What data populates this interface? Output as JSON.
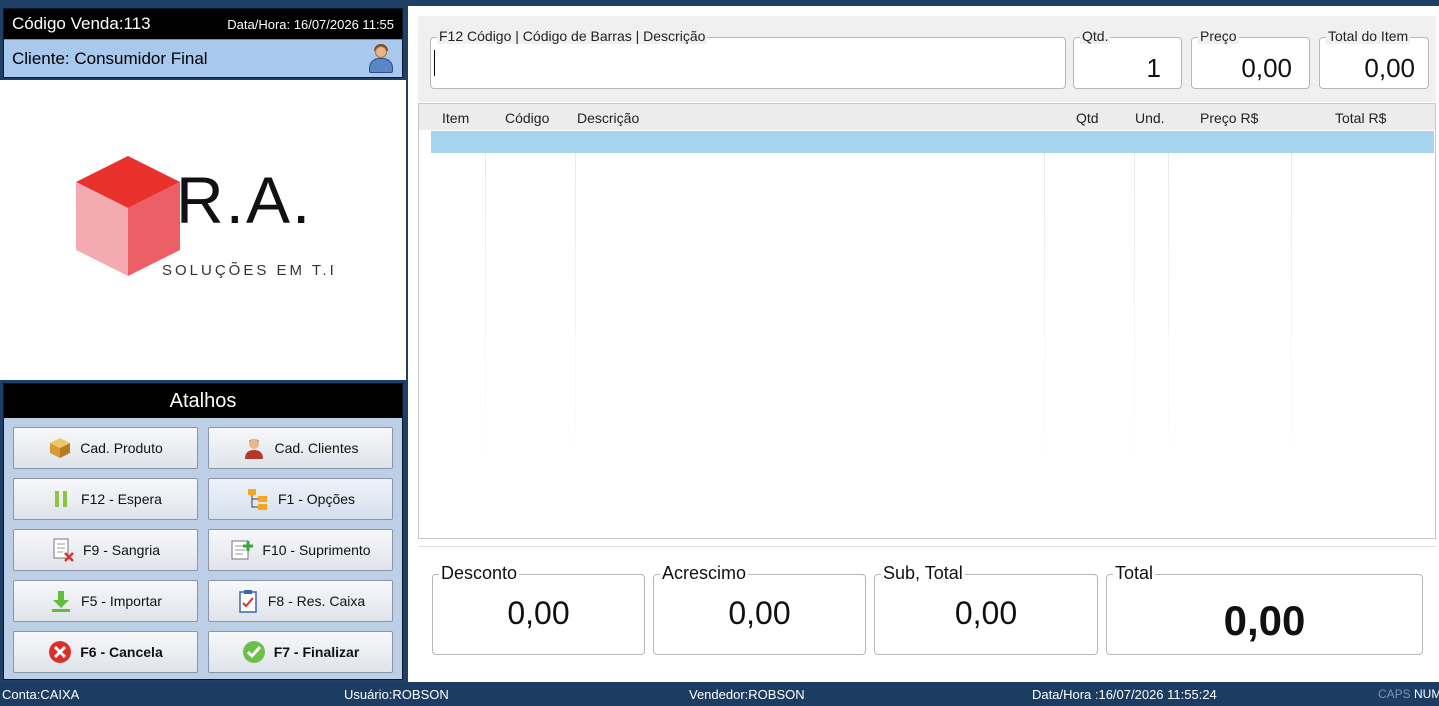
{
  "venda": {
    "codigo": "Código Venda:113",
    "data_hora": "Data/Hora: 16/07/2026 11:55",
    "cliente": "Cliente: Consumidor Final"
  },
  "logo": {
    "title": "R.A.",
    "subtitle": "SOLUÇÕES EM T.I"
  },
  "atalhos": {
    "title": "Atalhos",
    "buttons": [
      {
        "label": "Cad. Produto",
        "icon": "box-icon"
      },
      {
        "label": "Cad. Clientes",
        "icon": "user-icon"
      },
      {
        "label": "F12 - Espera",
        "icon": "pause-icon"
      },
      {
        "label": "F1 - Opções",
        "icon": "tree-options-icon"
      },
      {
        "label": "F9 - Sangria",
        "icon": "document-remove-icon"
      },
      {
        "label": "F10 - Suprimento",
        "icon": "document-add-icon"
      },
      {
        "label": "F5 - Importar",
        "icon": "download-icon"
      },
      {
        "label": "F8 - Res. Caixa",
        "icon": "clipboard-icon"
      },
      {
        "label": "F6 - Cancela",
        "icon": "cancel-icon"
      },
      {
        "label": "F7 - Finalizar",
        "icon": "check-icon"
      }
    ]
  },
  "entry": {
    "search_label": "F12  Código | Código de Barras | Descrição",
    "search_value": "",
    "qtd_label": "Qtd.",
    "qtd_value": "1",
    "preco_label": "Preço",
    "preco_value": "0,00",
    "total_item_label": "Total do Item",
    "total_item_value": "0,00"
  },
  "grid": {
    "columns": [
      "Item",
      "Código",
      "Descrição",
      "Qtd",
      "Und.",
      "Preço R$",
      "Total R$"
    ],
    "rows": []
  },
  "totals": {
    "desconto_label": "Desconto",
    "desconto_value": "0,00",
    "acrescimo_label": "Acrescimo",
    "acrescimo_value": "0,00",
    "subtotal_label": "Sub, Total",
    "subtotal_value": "0,00",
    "total_label": "Total",
    "total_value": "0,00"
  },
  "status": {
    "conta": "Conta:CAIXA",
    "usuario": "Usuário:ROBSON",
    "vendedor": "Vendedor:ROBSON",
    "data_hora": "Data/Hora :16/07/2026 11:55:24",
    "caps": "CAPS",
    "num": "NUM"
  }
}
